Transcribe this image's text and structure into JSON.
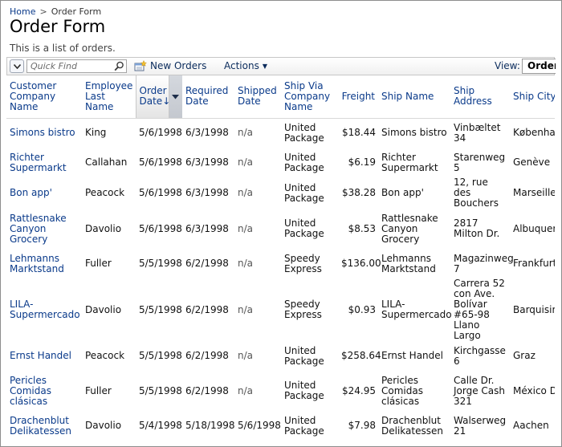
{
  "breadcrumb": {
    "home": "Home",
    "separator": ">",
    "current": "Order Form"
  },
  "page": {
    "title": "Order Form",
    "description": "This is a list of orders."
  },
  "toolbar": {
    "quick_find_placeholder": "Quick Find",
    "new_label": "New Orders",
    "actions_label": "Actions",
    "view_label": "View:",
    "view_value": "Orders"
  },
  "columns": [
    {
      "label": "Customer Company Name"
    },
    {
      "label": "Employee Last Name"
    },
    {
      "label": "Order Date",
      "sorted": "desc",
      "sort_indicator": "↓"
    },
    {
      "label": "Required Date"
    },
    {
      "label": "Shipped Date"
    },
    {
      "label": "Ship Via Company Name"
    },
    {
      "label": "Freight"
    },
    {
      "label": "Ship Name"
    },
    {
      "label": "Ship Address"
    },
    {
      "label": "Ship City"
    }
  ],
  "rows": [
    {
      "customer": "Simons bistro",
      "employee": "King",
      "order_date": "5/6/1998",
      "required_date": "6/3/1998",
      "shipped_date": "n/a",
      "ship_via": "United Package",
      "freight": "$18.44",
      "ship_name": "Simons bistro",
      "ship_address": "Vinbæltet 34",
      "ship_city": "København"
    },
    {
      "customer": "Richter Supermarkt",
      "employee": "Callahan",
      "order_date": "5/6/1998",
      "required_date": "6/3/1998",
      "shipped_date": "n/a",
      "ship_via": "United Package",
      "freight": "$6.19",
      "ship_name": "Richter Supermarkt",
      "ship_address": "Starenweg 5",
      "ship_city": "Genève"
    },
    {
      "customer": "Bon app'",
      "employee": "Peacock",
      "order_date": "5/6/1998",
      "required_date": "6/3/1998",
      "shipped_date": "n/a",
      "ship_via": "United Package",
      "freight": "$38.28",
      "ship_name": "Bon app'",
      "ship_address": "12, rue des Bouchers",
      "ship_city": "Marseille"
    },
    {
      "customer": "Rattlesnake Canyon Grocery",
      "employee": "Davolio",
      "order_date": "5/6/1998",
      "required_date": "6/3/1998",
      "shipped_date": "n/a",
      "ship_via": "United Package",
      "freight": "$8.53",
      "ship_name": "Rattlesnake Canyon Grocery",
      "ship_address": "2817 Milton Dr.",
      "ship_city": "Albuquerque"
    },
    {
      "customer": "Lehmanns Marktstand",
      "employee": "Fuller",
      "order_date": "5/5/1998",
      "required_date": "6/2/1998",
      "shipped_date": "n/a",
      "ship_via": "Speedy Express",
      "freight": "$136.00",
      "ship_name": "Lehmanns Marktstand",
      "ship_address": "Magazinweg 7",
      "ship_city": "Frankfurt a.M."
    },
    {
      "customer": "LILA-Supermercado",
      "employee": "Davolio",
      "order_date": "5/5/1998",
      "required_date": "6/2/1998",
      "shipped_date": "n/a",
      "ship_via": "Speedy Express",
      "freight": "$0.93",
      "ship_name": "LILA-Supermercado",
      "ship_address": "Carrera 52 con Ave. Bolívar #65-98 Llano Largo",
      "ship_city": "Barquisimeto"
    },
    {
      "customer": "Ernst Handel",
      "employee": "Peacock",
      "order_date": "5/5/1998",
      "required_date": "6/2/1998",
      "shipped_date": "n/a",
      "ship_via": "United Package",
      "freight": "$258.64",
      "ship_name": "Ernst Handel",
      "ship_address": "Kirchgasse 6",
      "ship_city": "Graz"
    },
    {
      "customer": "Pericles Comidas clásicas",
      "employee": "Fuller",
      "order_date": "5/5/1998",
      "required_date": "6/2/1998",
      "shipped_date": "n/a",
      "ship_via": "United Package",
      "freight": "$24.95",
      "ship_name": "Pericles Comidas clásicas",
      "ship_address": "Calle Dr. Jorge Cash 321",
      "ship_city": "México D.F."
    },
    {
      "customer": "Drachenblut Delikatessen",
      "employee": "Davolio",
      "order_date": "5/4/1998",
      "required_date": "5/18/1998",
      "shipped_date": "5/6/1998",
      "ship_via": "United Package",
      "freight": "$7.98",
      "ship_name": "Drachenblut Delikatessen",
      "ship_address": "Walserweg 21",
      "ship_city": "Aachen"
    }
  ]
}
